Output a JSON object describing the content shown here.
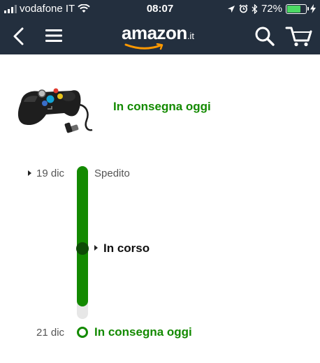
{
  "status_bar": {
    "carrier": "vodafone IT",
    "time": "08:07",
    "battery_percent": "72%",
    "battery_level": 0.72,
    "icons": [
      "signal-icon",
      "wifi-icon",
      "location-icon",
      "alarm-icon",
      "bluetooth-icon",
      "battery-icon",
      "charging-icon"
    ]
  },
  "nav": {
    "logo_word": "amazon",
    "logo_tld": ".it",
    "icons": [
      "back-icon",
      "menu-icon",
      "search-icon",
      "cart-icon"
    ]
  },
  "product": {
    "image_description_icon": "gamepad-controller-image",
    "status": "In consegna oggi"
  },
  "timeline": {
    "start_date": "19 dic",
    "start_label": "Spedito",
    "current_label": "In corso",
    "end_date": "21 dic",
    "end_label": "In consegna oggi",
    "progress": 0.92
  },
  "colors": {
    "header_bg": "#232f3e",
    "green": "#138a00",
    "dark_green": "#0d4a06",
    "smile": "#ff9900"
  }
}
